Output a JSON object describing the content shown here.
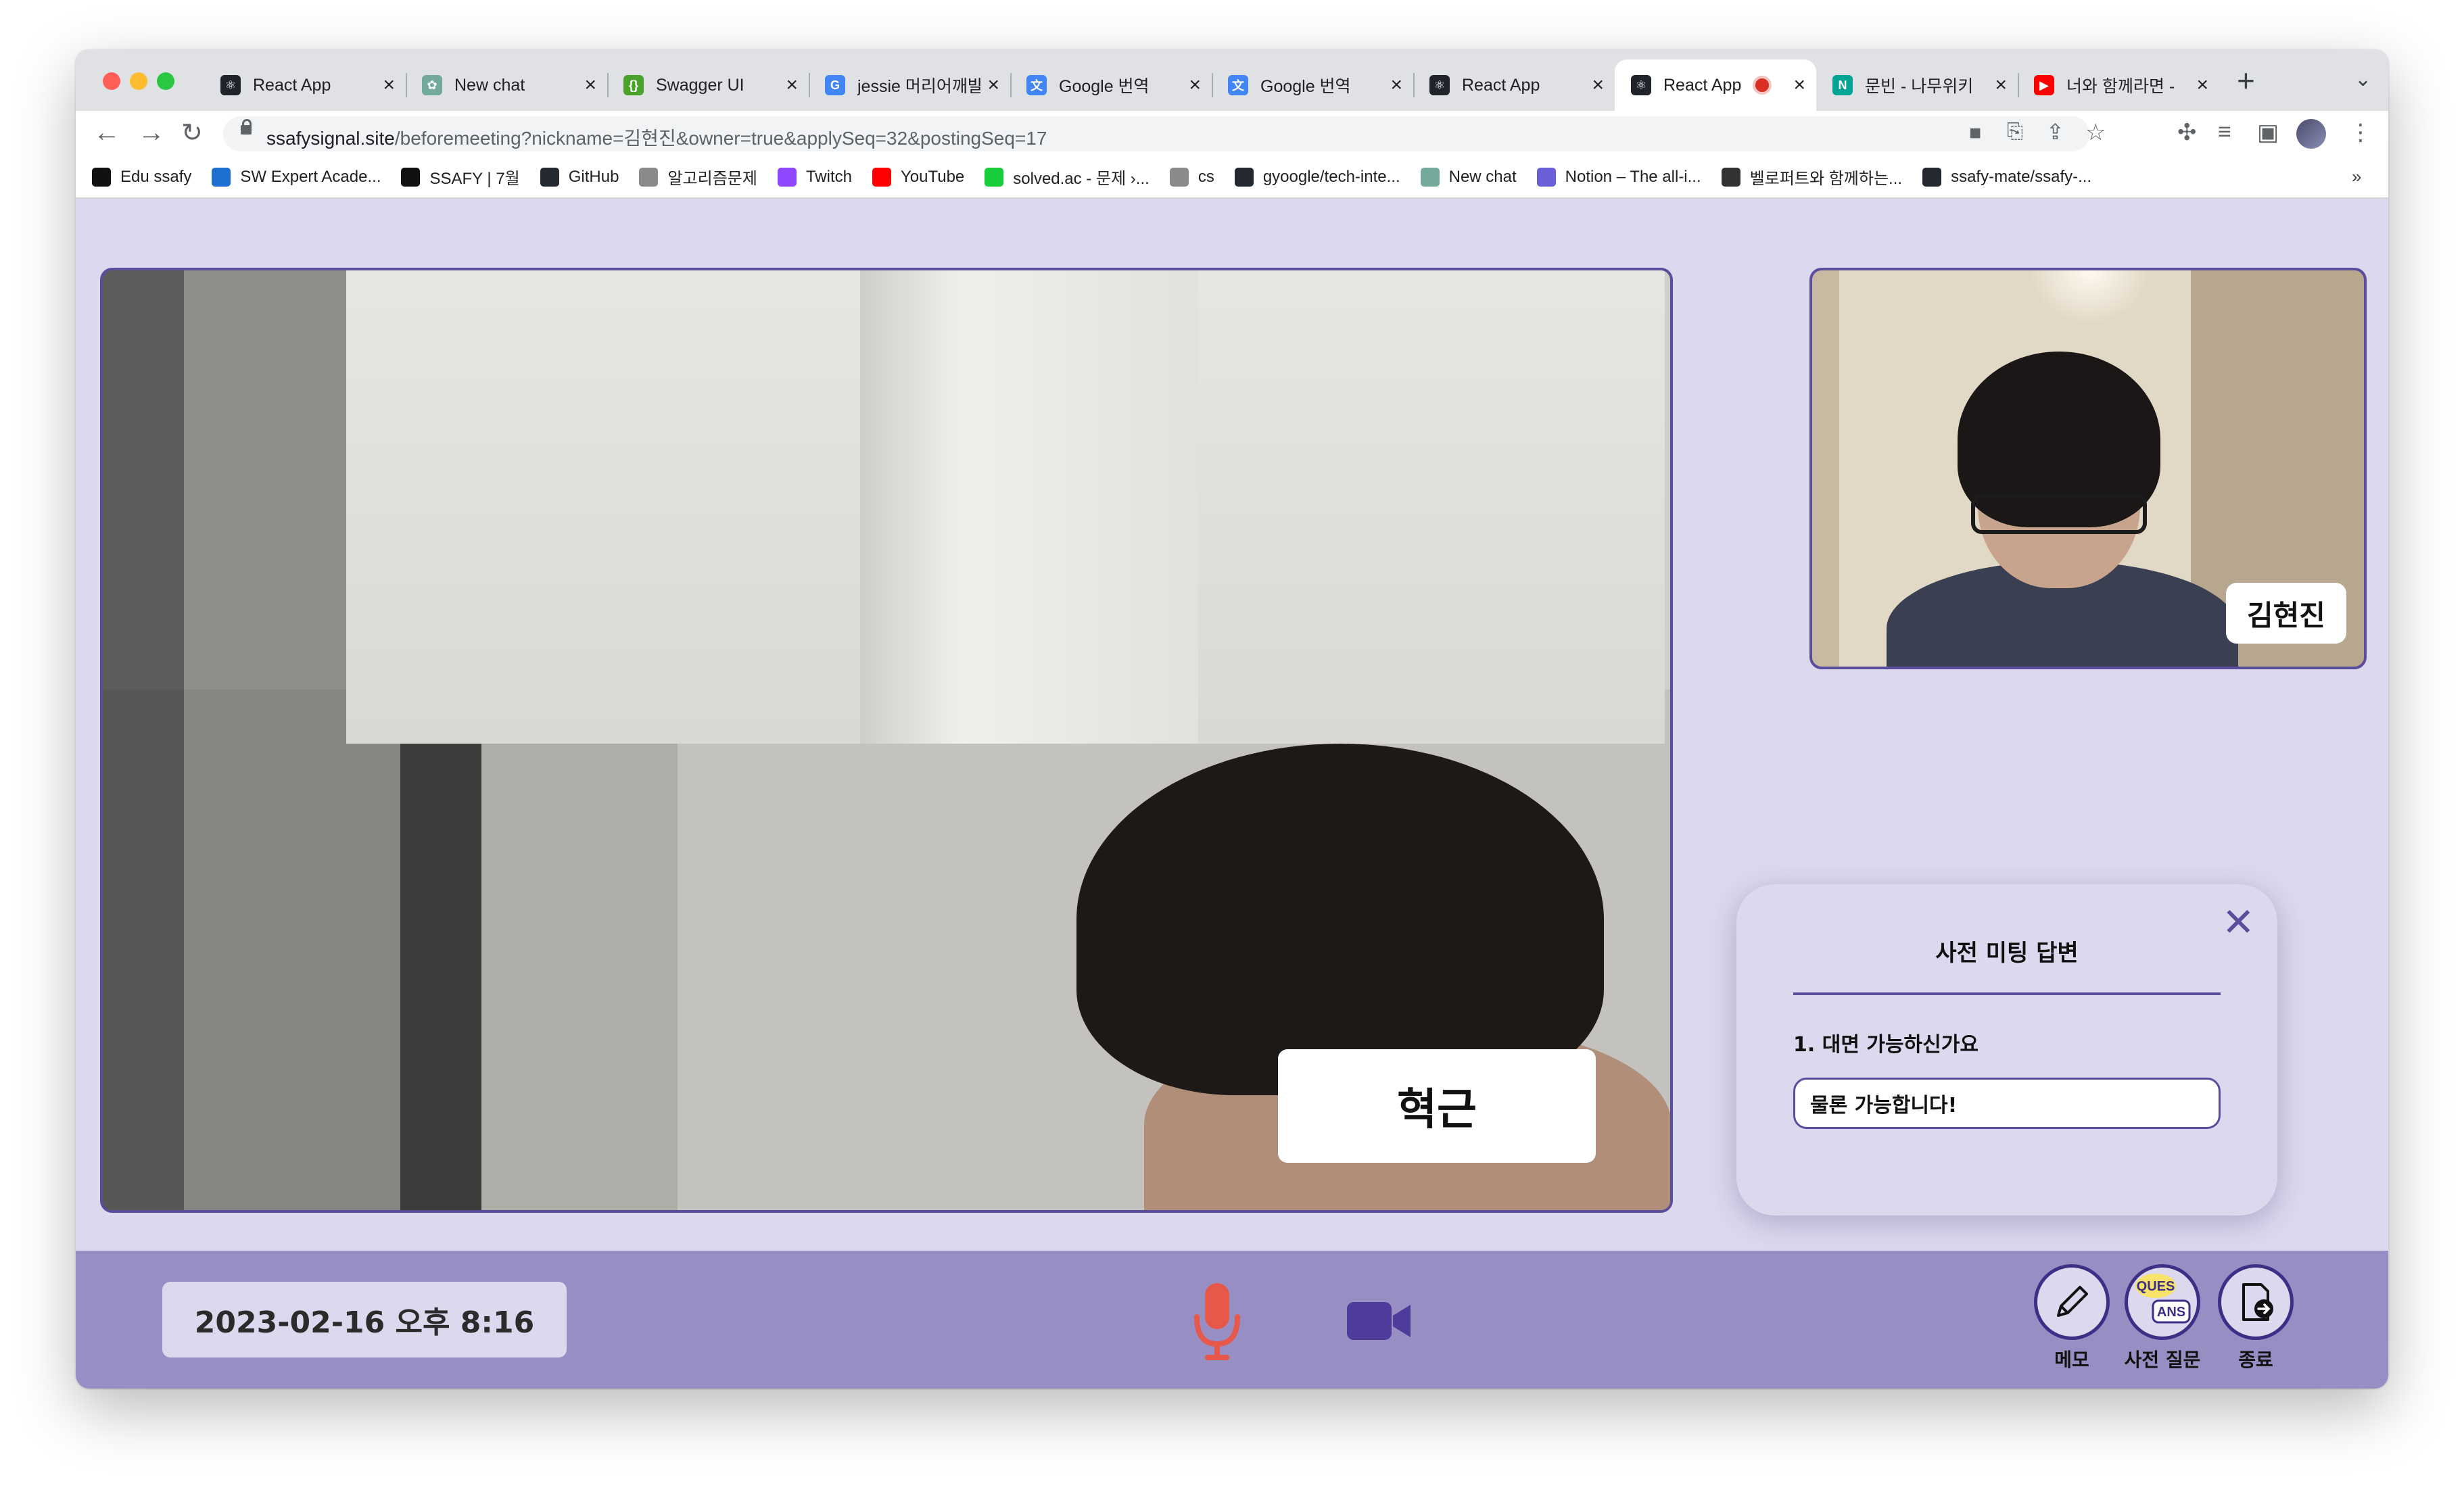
{
  "browser": {
    "tabs": [
      {
        "title": "React App",
        "icon": "react",
        "color": "#20232a"
      },
      {
        "title": "New chat",
        "icon": "chatgpt",
        "color": "#74aa9c"
      },
      {
        "title": "Swagger UI",
        "icon": "swagger",
        "color": "#49a32b"
      },
      {
        "title": "jessie 머리어깨발",
        "icon": "google",
        "color": "#4285f4"
      },
      {
        "title": "Google 번역",
        "icon": "translate",
        "color": "#4285f4"
      },
      {
        "title": "Google 번역",
        "icon": "translate",
        "color": "#4285f4"
      },
      {
        "title": "React App",
        "icon": "react",
        "color": "#20232a"
      },
      {
        "title": "React App",
        "icon": "react",
        "color": "#20232a",
        "active": true,
        "recording": true
      },
      {
        "title": "문빈 - 나무위키",
        "icon": "namuwiki",
        "color": "#00a495"
      },
      {
        "title": "너와 함께라면 -",
        "icon": "youtube",
        "color": "#ff0000"
      }
    ],
    "url_host": "ssafysignal.site",
    "url_path": "/beforemeeting?nickname=김현진&owner=true&applySeq=32&postingSeq=17",
    "bookmarks": [
      {
        "label": "Edu ssafy",
        "color": "#111111"
      },
      {
        "label": "SW Expert Acade...",
        "color": "#1f6fd1"
      },
      {
        "label": "SSAFY | 7월",
        "color": "#111111"
      },
      {
        "label": "GitHub",
        "color": "#24292f"
      },
      {
        "label": "알고리즘문제",
        "color": "#8a8a8a"
      },
      {
        "label": "Twitch",
        "color": "#9146ff"
      },
      {
        "label": "YouTube",
        "color": "#ff0000"
      },
      {
        "label": "solved.ac - 문제 ›...",
        "color": "#17ce3a"
      },
      {
        "label": "cs",
        "color": "#8a8a8a"
      },
      {
        "label": "gyoogle/tech-inte...",
        "color": "#24292f"
      },
      {
        "label": "New chat",
        "color": "#74aa9c"
      },
      {
        "label": "Notion – The all-i...",
        "color": "#6b5fd8"
      },
      {
        "label": "벨로퍼트와 함께하는...",
        "color": "#333333"
      },
      {
        "label": "ssafy-mate/ssafy-...",
        "color": "#24292f"
      }
    ],
    "more_bookmarks": "»"
  },
  "meeting": {
    "main_video_name": "혁근",
    "small_video_name": "김현진",
    "panel": {
      "title": "사전 미팅 답변",
      "question": "1. 대면 가능하신가요",
      "answer": "물론 가능합니다!",
      "close": "✕"
    },
    "datetime": "2023-02-16 오후 8:16",
    "buttons": {
      "memo": "메모",
      "questions": "사전 질문",
      "exit": "종료",
      "ques_badge": "QUES",
      "ans_badge": "ANS"
    },
    "colors": {
      "accent": "#5b4d9c",
      "mic": "#e8584a",
      "camera": "#4e3b9a",
      "bar": "#978fc4",
      "page_bg": "#dcd8ee"
    }
  }
}
